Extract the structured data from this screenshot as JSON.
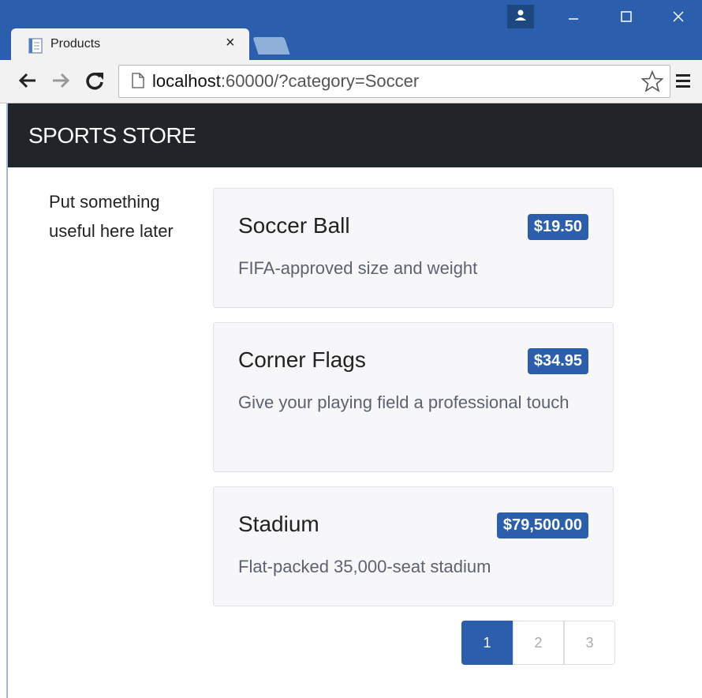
{
  "browser": {
    "tab_title": "Products",
    "tab_close": "×",
    "url_host": "localhost",
    "url_rest": ":60000/?category=Soccer"
  },
  "store": {
    "brand": "SPORTS STORE",
    "sidebar_text": "Put something useful here later"
  },
  "products": [
    {
      "name": "Soccer Ball",
      "price": "$19.50",
      "description": "FIFA-approved size and weight"
    },
    {
      "name": "Corner Flags",
      "price": "$34.95",
      "description": "Give your playing field a professional touch"
    },
    {
      "name": "Stadium",
      "price": "$79,500.00",
      "description": "Flat-packed 35,000-seat stadium"
    }
  ],
  "pagination": {
    "pages": [
      "1",
      "2",
      "3"
    ],
    "current": "1"
  },
  "colors": {
    "accent": "#2b5fad",
    "navbar": "#212529",
    "card_bg": "#f7f7f9",
    "description": "#5b6370"
  }
}
